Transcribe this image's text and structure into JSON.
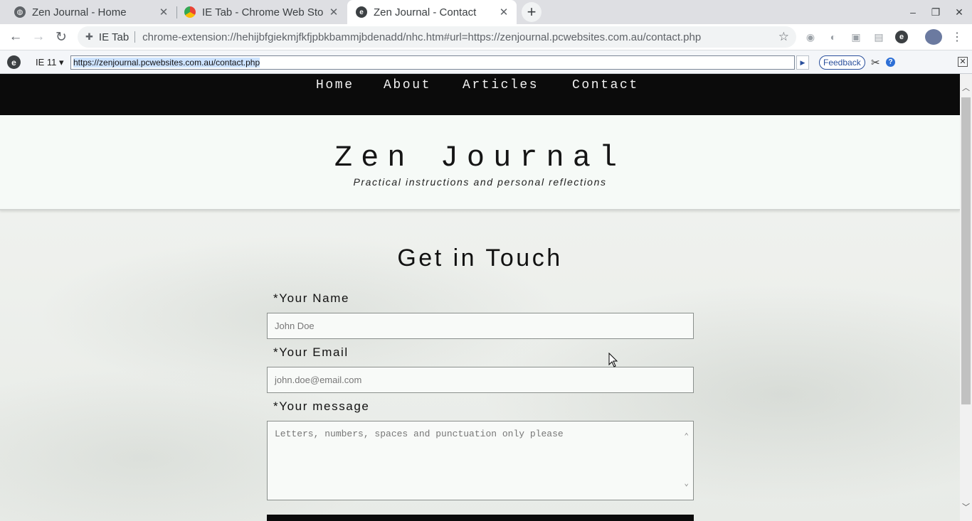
{
  "browser": {
    "tabs": [
      {
        "title": "Zen Journal - Home",
        "active": false
      },
      {
        "title": "IE Tab - Chrome Web Store",
        "active": false
      },
      {
        "title": "Zen Journal - Contact",
        "active": true
      }
    ],
    "new_tab_label": "+",
    "window_controls": {
      "minimize": "–",
      "restore": "❐",
      "close": "✕"
    },
    "toolbar": {
      "back": "←",
      "forward": "→",
      "reload": "↻",
      "extension_chip": "IE Tab",
      "url": "chrome-extension://hehijbfgiekmjfkfjpbkbammjbdenadd/nhc.htm#url=https://zenjournal.pcwebsites.com.au/contact.php",
      "star": "☆"
    }
  },
  "ietab": {
    "mode": "IE 11 ▾",
    "url": "https://zenjournal.pcwebsites.com.au/contact.php",
    "go": "▶",
    "feedback": "Feedback",
    "help": "?",
    "close": "✕"
  },
  "site": {
    "nav": [
      "Home",
      "About",
      "Articles",
      "Contact"
    ],
    "title": "Zen Journal",
    "subtitle": "Practical instructions and personal reflections",
    "heading": "Get in Touch",
    "form": {
      "name_label": "*Your Name",
      "name_placeholder": "John Doe",
      "email_label": "*Your Email",
      "email_placeholder": "john.doe@email.com",
      "message_label": "*Your message",
      "message_placeholder": "Letters, numbers, spaces and punctuation only please"
    }
  },
  "colors": {
    "nav_bg": "#0b0b0b",
    "header_bg": "#f6faf7",
    "tabstrip_bg": "#dedfe3",
    "ie_accent": "#2a4f9c"
  }
}
